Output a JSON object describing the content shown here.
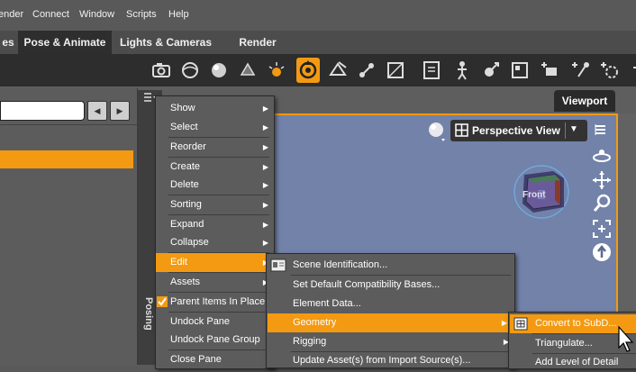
{
  "menubar": {
    "items": [
      "ender",
      "Connect",
      "Window",
      "Scripts",
      "Help"
    ]
  },
  "tabs": [
    "es",
    "Pose & Animate",
    "Lights & Cameras",
    "Render"
  ],
  "viewport": {
    "tab_label": "Viewport",
    "view_mode": "Perspective View",
    "cube_face": "Front"
  },
  "posing_label": "Posing",
  "context_menu": {
    "items": [
      {
        "label": "Show",
        "submenu": true
      },
      {
        "label": "Select",
        "submenu": true
      },
      {
        "label": "Reorder",
        "submenu": true
      },
      {
        "label": "Create",
        "submenu": true
      },
      {
        "label": "Delete",
        "submenu": true
      },
      {
        "label": "Sorting",
        "submenu": true
      },
      {
        "label": "Expand",
        "submenu": true
      },
      {
        "label": "Collapse",
        "submenu": true
      },
      {
        "label": "Edit",
        "submenu": true,
        "highlighted": true
      },
      {
        "label": "Assets",
        "submenu": true
      },
      {
        "label": "Parent Items In Place",
        "checked": true
      },
      {
        "label": "Undock Pane"
      },
      {
        "label": "Undock Pane Group"
      },
      {
        "label": "Close Pane"
      }
    ]
  },
  "edit_submenu": {
    "items": [
      {
        "label": "Scene Identification..."
      },
      {
        "label": "Set Default Compatibility Bases..."
      },
      {
        "label": "Element Data..."
      },
      {
        "label": "Geometry",
        "submenu": true,
        "highlighted": true
      },
      {
        "label": "Rigging",
        "submenu": true
      },
      {
        "label": "Update Asset(s) from Import Source(s)..."
      }
    ]
  },
  "geometry_submenu": {
    "items": [
      {
        "label": "Convert to SubD...",
        "highlighted": true
      },
      {
        "label": "Triangulate..."
      },
      {
        "label": "Add Level of Detail"
      }
    ]
  },
  "colors": {
    "accent": "#f39a12",
    "viewport_bg": "#7282a8",
    "menu_bg": "#5c5c5c",
    "toolbar_bg": "#2d2d2d"
  }
}
